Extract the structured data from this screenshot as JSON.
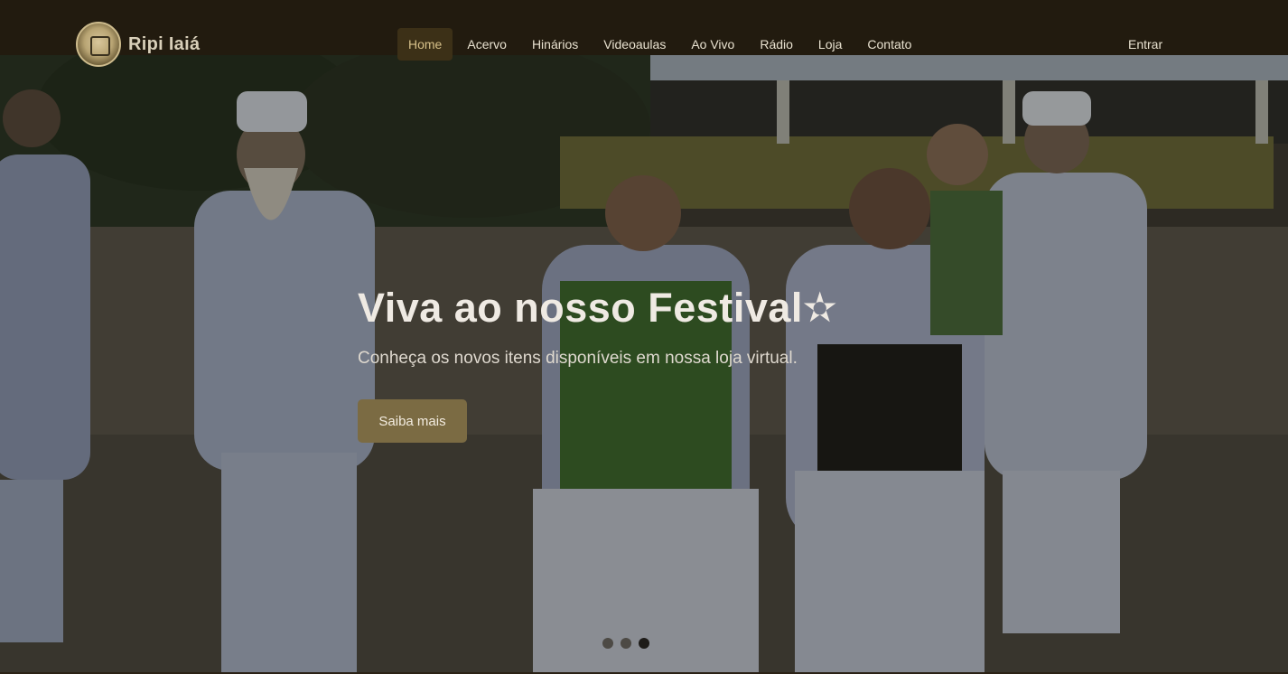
{
  "brand": {
    "name": "Ripi Iaiá",
    "logo_icon": "seal-logo-icon"
  },
  "nav": {
    "items": [
      {
        "label": "Home",
        "active": true
      },
      {
        "label": "Acervo"
      },
      {
        "label": "Hinários"
      },
      {
        "label": "Videoaulas"
      },
      {
        "label": "Ao Vivo"
      },
      {
        "label": "Rádio"
      },
      {
        "label": "Loja"
      },
      {
        "label": "Contato"
      }
    ],
    "login_label": "Entrar"
  },
  "hero": {
    "title": "Viva ao nosso Festival✫",
    "subtitle": "Conheça os novos itens disponíveis em nossa loja virtual.",
    "button_label": "Saiba mais",
    "slides": {
      "count": 3,
      "active_index": 2
    }
  },
  "colors": {
    "header_bg": "#221b0f",
    "accent": "#7b6b43",
    "nav_active_bg": "#3c3017"
  }
}
